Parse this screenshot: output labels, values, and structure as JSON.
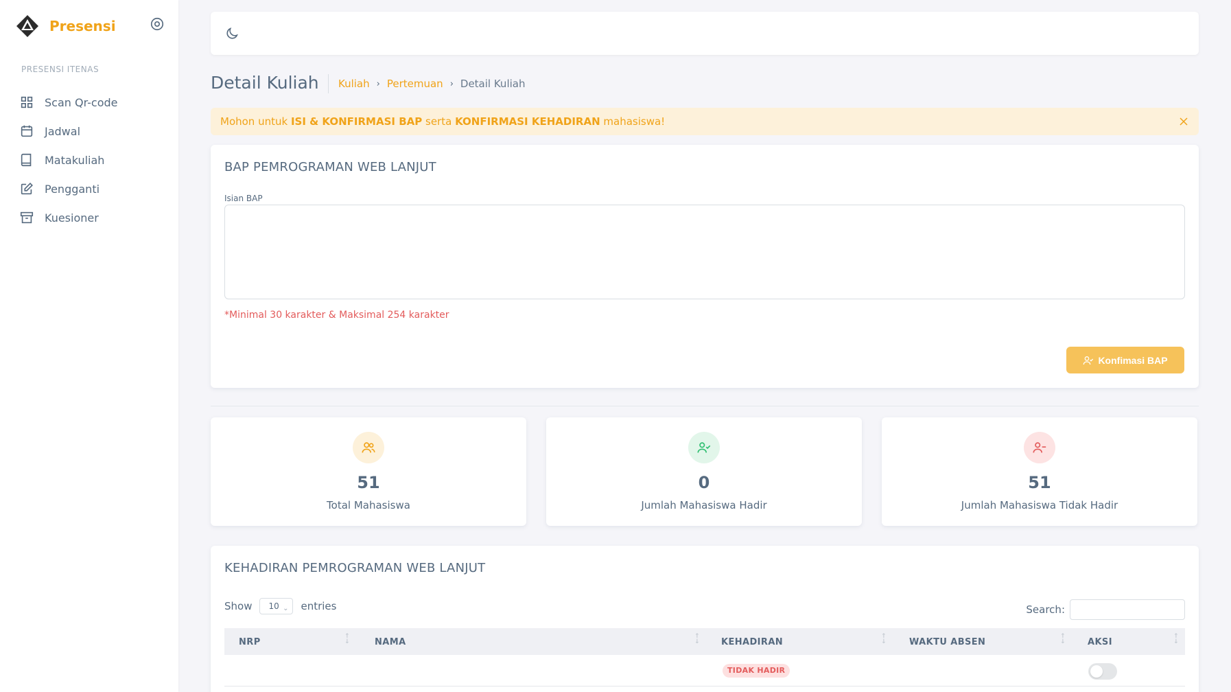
{
  "app": {
    "brand": "Presensi"
  },
  "sidebar": {
    "header": "PRESENSI ITENAS",
    "items": [
      {
        "label": "Scan Qr-code",
        "icon": "grid-icon"
      },
      {
        "label": "Jadwal",
        "icon": "calendar-icon"
      },
      {
        "label": "Matakuliah",
        "icon": "book-icon"
      },
      {
        "label": "Pengganti",
        "icon": "edit-icon"
      },
      {
        "label": "Kuesioner",
        "icon": "archive-icon"
      }
    ]
  },
  "page": {
    "title": "Detail Kuliah",
    "breadcrumb": [
      "Kuliah",
      "Pertemuan",
      "Detail Kuliah"
    ]
  },
  "alert": {
    "prefix": "Mohon untuk ",
    "strong1": "ISI & KONFIRMASI BAP",
    "middle": " serta ",
    "strong2": "KONFIRMASI KEHADIRAN",
    "suffix": " mahasiswa!"
  },
  "bap": {
    "title": "BAP PEMROGRAMAN WEB LANJUT",
    "label": "Isian BAP",
    "value": "",
    "note": "*Minimal 30 karakter & Maksimal 254 karakter",
    "button": "Konfimasi BAP"
  },
  "stats": [
    {
      "value": "51",
      "label": "Total Mahasiswa",
      "color": "#f0a319",
      "bg": "#fdf1da"
    },
    {
      "value": "0",
      "label": "Jumlah Mahasiswa Hadir",
      "color": "#2fbf71",
      "bg": "#e2f6ea"
    },
    {
      "value": "51",
      "label": "Jumlah Mahasiswa Tidak Hadir",
      "color": "#e35b5b",
      "bg": "#fde3e3"
    }
  ],
  "attendance": {
    "title": "KEHADIRAN PEMROGRAMAN WEB LANJUT",
    "show_label": "Show",
    "entries_value": "10",
    "entries_label": "entries",
    "search_label": "Search:",
    "columns": [
      "NRP",
      "NAMA",
      "KEHADIRAN",
      "WAKTU ABSEN",
      "AKSI"
    ],
    "rows": [
      {
        "nrp": "",
        "nama": "",
        "kehadiran": "TIDAK HADIR",
        "waktu": "",
        "aksi_on": false
      }
    ]
  },
  "colors": {
    "accent": "#f0a319",
    "danger": "#e35b5b",
    "success": "#2fbf71"
  }
}
